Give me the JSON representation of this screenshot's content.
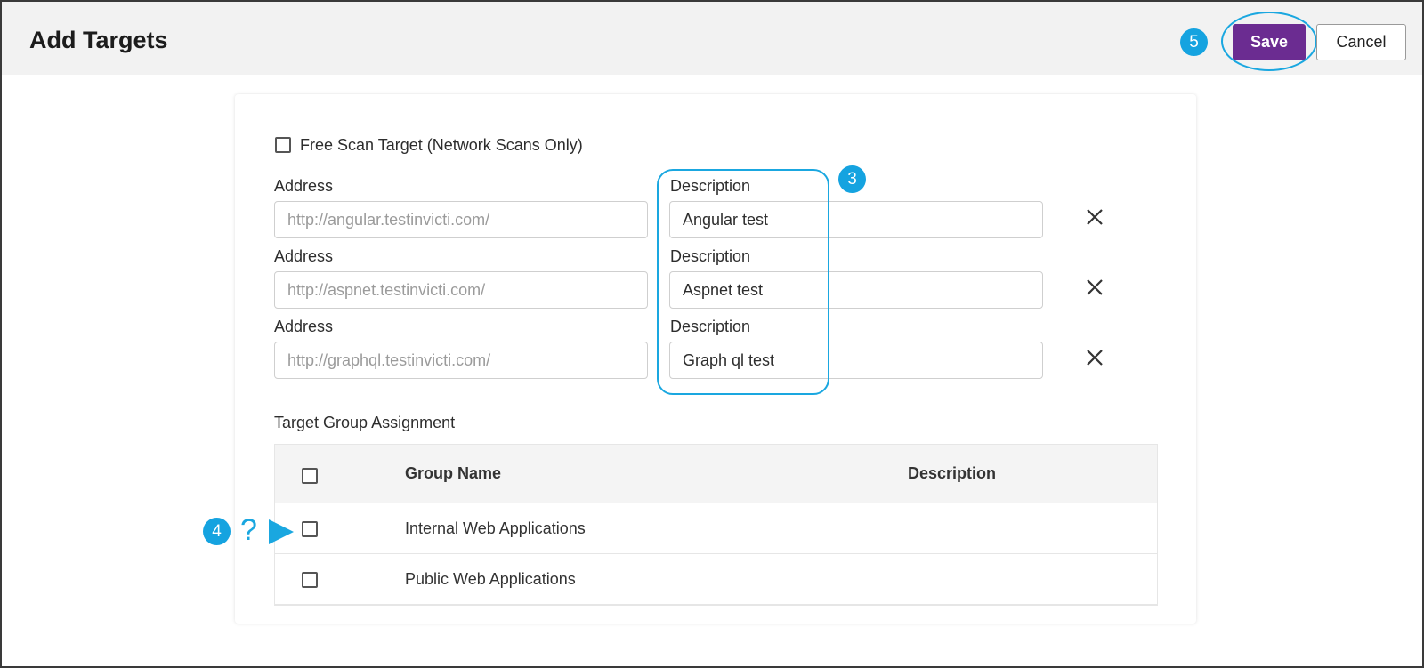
{
  "header": {
    "title": "Add Targets",
    "save_label": "Save",
    "cancel_label": "Cancel"
  },
  "callouts": {
    "save_step": "5",
    "description_step": "3",
    "group_step": "4",
    "question_mark": "?"
  },
  "form": {
    "free_scan_label": "Free Scan Target (Network Scans Only)",
    "free_scan_checked": false,
    "targets": [
      {
        "address_label": "Address",
        "address_placeholder": "http://angular.testinvicti.com/",
        "description_label": "Description",
        "description_value": "Angular test"
      },
      {
        "address_label": "Address",
        "address_placeholder": "http://aspnet.testinvicti.com/",
        "description_label": "Description",
        "description_value": "Aspnet test"
      },
      {
        "address_label": "Address",
        "address_placeholder": "http://graphql.testinvicti.com/",
        "description_label": "Description",
        "description_value": "Graph ql test"
      }
    ],
    "group_assignment_label": "Target Group Assignment"
  },
  "group_table": {
    "columns": [
      "Group Name",
      "Description"
    ],
    "rows": [
      {
        "name": "Internal Web Applications",
        "description": ""
      },
      {
        "name": "Public Web Applications",
        "description": ""
      }
    ]
  },
  "colors": {
    "accent": "#6b2c91",
    "callout": "#1aa7e0"
  }
}
